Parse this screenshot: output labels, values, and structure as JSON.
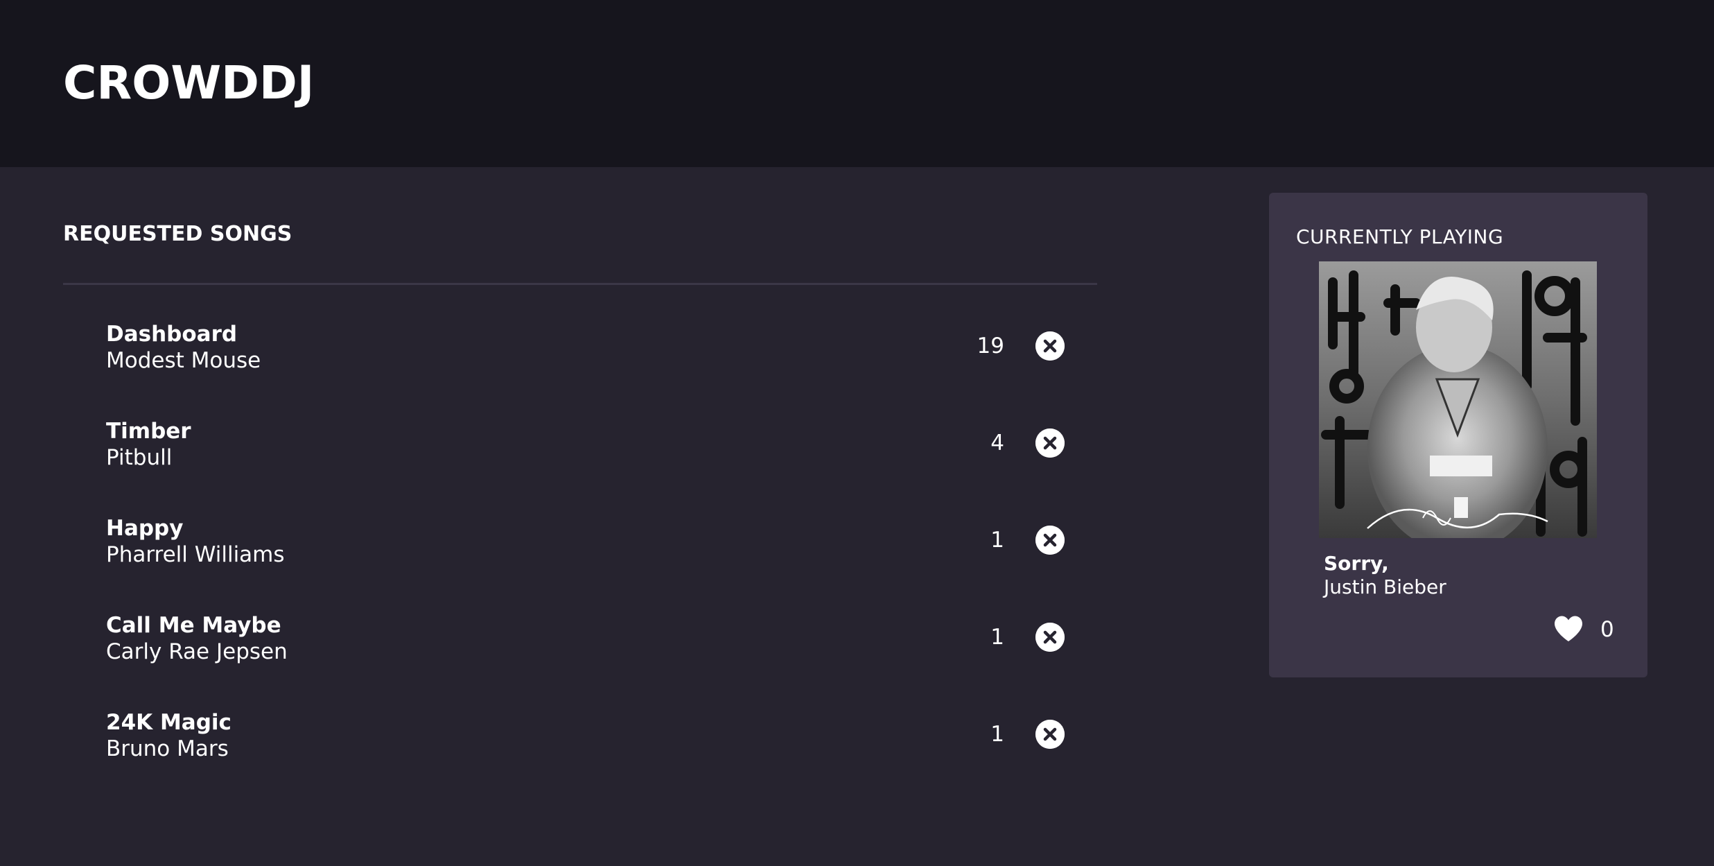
{
  "header": {
    "brand": "CROWDDJ"
  },
  "requests": {
    "title": "REQUESTED SONGS",
    "songs": [
      {
        "title": "Dashboard",
        "artist": "Modest Mouse",
        "votes": "19"
      },
      {
        "title": "Timber",
        "artist": "Pitbull",
        "votes": "4"
      },
      {
        "title": "Happy",
        "artist": "Pharrell Williams",
        "votes": "1"
      },
      {
        "title": "Call Me Maybe",
        "artist": "Carly Rae Jepsen",
        "votes": "1"
      },
      {
        "title": "24K Magic",
        "artist": "Bruno Mars",
        "votes": "1"
      }
    ],
    "remove_icon": "close-circle-icon"
  },
  "now_playing": {
    "label": "CURRENTLY PLAYING",
    "title": "Sorry,",
    "artist": "Justin Bieber",
    "likes": "0",
    "like_icon": "heart-icon",
    "album_art_signature": "Purpose"
  },
  "colors": {
    "header_bg": "#16151d",
    "page_bg": "#26232f",
    "card_bg": "#3b3547",
    "divider": "#3b3747",
    "text": "#ffffff"
  }
}
